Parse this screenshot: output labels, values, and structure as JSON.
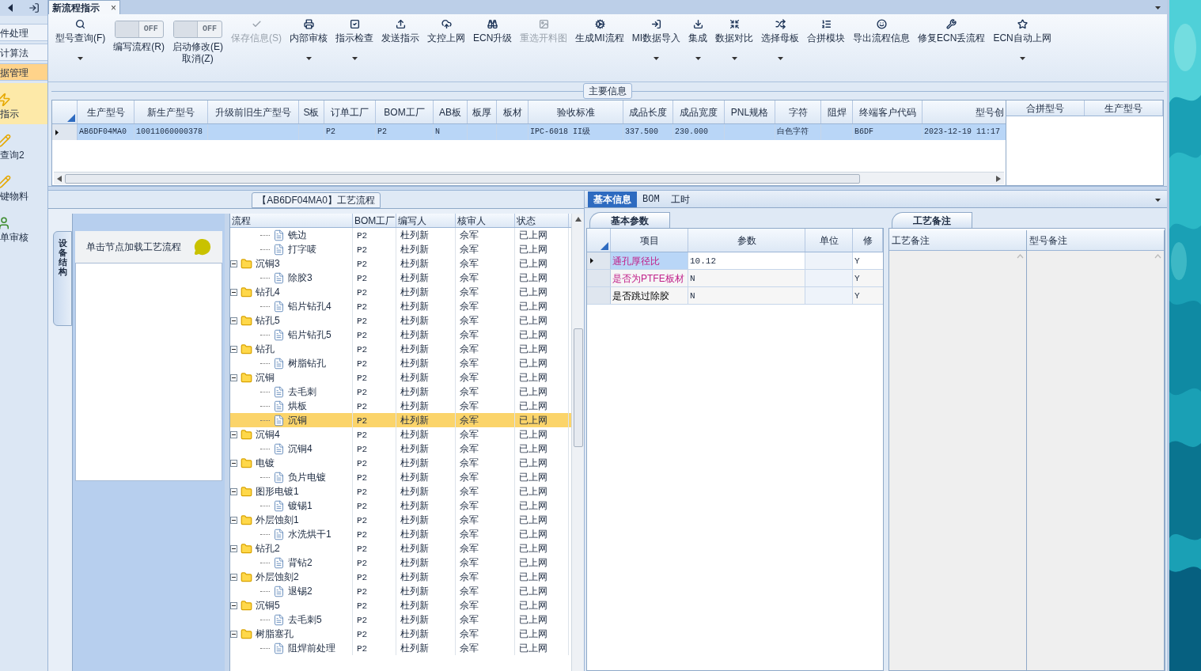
{
  "sidebar": {
    "items": [
      {
        "label": "件处理",
        "kind": "group",
        "selected": false
      },
      {
        "label": "计算法",
        "kind": "group",
        "selected": false
      },
      {
        "label": "据管理",
        "kind": "group",
        "selected": true
      },
      {
        "label": "指示",
        "kind": "item",
        "selected": true
      },
      {
        "label": "查询2",
        "kind": "item",
        "selected": false
      },
      {
        "label": "键物料",
        "kind": "item",
        "selected": false
      },
      {
        "label": "单审核",
        "kind": "item",
        "selected": false
      }
    ]
  },
  "document_tab": {
    "title": "新流程指示",
    "close": "×"
  },
  "toolbar": [
    {
      "label": "型号查询(F)",
      "kind": "button",
      "disabled": false,
      "dropdown": true
    },
    {
      "label": "编写流程(R)",
      "kind": "toggle",
      "on": false,
      "switch_text": "OFF"
    },
    {
      "label": "启动修改(E)",
      "sublabel": "取消(Z)",
      "kind": "toggle",
      "on": false,
      "switch_text": "OFF"
    },
    {
      "label": "保存信息(S)",
      "kind": "button",
      "disabled": true,
      "dropdown": false
    },
    {
      "label": "内部审核",
      "kind": "button",
      "disabled": false,
      "dropdown": true
    },
    {
      "label": "指示检查",
      "kind": "button",
      "disabled": false,
      "dropdown": true
    },
    {
      "label": "发送指示",
      "kind": "button",
      "disabled": false,
      "dropdown": false
    },
    {
      "label": "文控上网",
      "kind": "button",
      "disabled": false,
      "dropdown": false
    },
    {
      "label": "ECN升级",
      "kind": "button",
      "disabled": false,
      "dropdown": false
    },
    {
      "label": "重选开料图",
      "kind": "button",
      "disabled": true,
      "dropdown": false
    },
    {
      "label": "生成MI流程",
      "kind": "button",
      "disabled": false,
      "dropdown": false
    },
    {
      "label": "MI数据导入",
      "kind": "button",
      "disabled": false,
      "dropdown": true
    },
    {
      "label": "集成",
      "kind": "button",
      "disabled": false,
      "dropdown": true
    },
    {
      "label": "数据对比",
      "kind": "button",
      "disabled": false,
      "dropdown": true
    },
    {
      "label": "选择母板",
      "kind": "button",
      "disabled": false,
      "dropdown": true
    },
    {
      "label": "合拼模块",
      "kind": "button",
      "disabled": false,
      "dropdown": false
    },
    {
      "label": "导出流程信息",
      "kind": "button",
      "disabled": false,
      "dropdown": false
    },
    {
      "label": "修复ECN丢流程",
      "kind": "button",
      "disabled": false,
      "dropdown": false
    },
    {
      "label": "ECN自动上网",
      "kind": "button",
      "disabled": false,
      "dropdown": true
    }
  ],
  "main_info": {
    "title": "主要信息",
    "table": {
      "columns": [
        "生产型号",
        "新生产型号",
        "升级前旧生产型号",
        "S板",
        "订单工厂",
        "BOM工厂",
        "AB板",
        "板厚",
        "板材",
        "验收标准",
        "成品长度",
        "成品宽度",
        "PNL规格",
        "字符",
        "阻焊",
        "终端客户代码",
        "型号创"
      ],
      "rows": [
        {
          "selected": true,
          "cells": [
            "AB6DF04MA0",
            "10011060000378",
            null,
            null,
            "P2",
            "P2",
            "N",
            null,
            null,
            "IPC-6018 II级",
            "337.500",
            "230.000",
            null,
            "白色字符",
            null,
            "B6DF",
            "2023-12-19 11:17"
          ]
        }
      ]
    },
    "merge_table": {
      "columns": [
        "合拼型号",
        "生产型号"
      ]
    }
  },
  "flow": {
    "title": "【AB6DF04MA0】工艺流程",
    "side_tab": "设备结构",
    "hint": "单击节点加载工艺流程",
    "columns": [
      "流程",
      "BOM工厂",
      "编写人",
      "核审人",
      "状态"
    ],
    "rows": [
      {
        "name": "铣边",
        "kind": "file",
        "bom_factory": "P2",
        "writer": "杜列新",
        "reviewer": "佘军",
        "status": "已上网",
        "selected": false
      },
      {
        "name": "打字唛",
        "kind": "file",
        "bom_factory": "P2",
        "writer": "杜列新",
        "reviewer": "佘军",
        "status": "已上网",
        "selected": false
      },
      {
        "name": "沉铜3",
        "kind": "folder",
        "expanded": true,
        "bom_factory": "P2",
        "writer": "杜列新",
        "reviewer": "佘军",
        "status": "已上网",
        "selected": false,
        "children": [
          {
            "name": "除胶3",
            "kind": "file",
            "bom_factory": "P2",
            "writer": "杜列新",
            "reviewer": "佘军",
            "status": "已上网",
            "selected": false
          }
        ]
      },
      {
        "name": "钻孔4",
        "kind": "folder",
        "expanded": true,
        "bom_factory": "P2",
        "writer": "杜列新",
        "reviewer": "佘军",
        "status": "已上网",
        "selected": false,
        "children": [
          {
            "name": "铝片钻孔4",
            "kind": "file",
            "bom_factory": "P2",
            "writer": "杜列新",
            "reviewer": "佘军",
            "status": "已上网",
            "selected": false
          }
        ]
      },
      {
        "name": "钻孔5",
        "kind": "folder",
        "expanded": true,
        "bom_factory": "P2",
        "writer": "杜列新",
        "reviewer": "佘军",
        "status": "已上网",
        "selected": false,
        "children": [
          {
            "name": "铝片钻孔5",
            "kind": "file",
            "bom_factory": "P2",
            "writer": "杜列新",
            "reviewer": "佘军",
            "status": "已上网",
            "selected": false
          }
        ]
      },
      {
        "name": "钻孔",
        "kind": "folder",
        "expanded": true,
        "bom_factory": "P2",
        "writer": "杜列新",
        "reviewer": "佘军",
        "status": "已上网",
        "selected": false,
        "children": [
          {
            "name": "树脂钻孔",
            "kind": "file",
            "bom_factory": "P2",
            "writer": "杜列新",
            "reviewer": "佘军",
            "status": "已上网",
            "selected": false
          }
        ]
      },
      {
        "name": "沉铜",
        "kind": "folder",
        "expanded": true,
        "bom_factory": "P2",
        "writer": "杜列新",
        "reviewer": "佘军",
        "status": "已上网",
        "selected": false,
        "children": [
          {
            "name": "去毛刺",
            "kind": "file",
            "bom_factory": "P2",
            "writer": "杜列新",
            "reviewer": "佘军",
            "status": "已上网",
            "selected": false
          },
          {
            "name": "烘板",
            "kind": "file",
            "bom_factory": "P2",
            "writer": "杜列新",
            "reviewer": "佘军",
            "status": "已上网",
            "selected": false
          },
          {
            "name": "沉铜",
            "kind": "file",
            "bom_factory": "P2",
            "writer": "杜列新",
            "reviewer": "佘军",
            "status": "已上网",
            "selected": true
          }
        ]
      },
      {
        "name": "沉铜4",
        "kind": "folder",
        "expanded": true,
        "bom_factory": "P2",
        "writer": "杜列新",
        "reviewer": "佘军",
        "status": "已上网",
        "selected": false,
        "children": [
          {
            "name": "沉铜4",
            "kind": "file",
            "bom_factory": "P2",
            "writer": "杜列新",
            "reviewer": "佘军",
            "status": "已上网",
            "selected": false
          }
        ]
      },
      {
        "name": "电镀",
        "kind": "folder",
        "expanded": true,
        "bom_factory": "P2",
        "writer": "杜列新",
        "reviewer": "佘军",
        "status": "已上网",
        "selected": false,
        "children": [
          {
            "name": "负片电镀",
            "kind": "file",
            "bom_factory": "P2",
            "writer": "杜列新",
            "reviewer": "佘军",
            "status": "已上网",
            "selected": false
          }
        ]
      },
      {
        "name": "图形电镀1",
        "kind": "folder",
        "expanded": true,
        "bom_factory": "P2",
        "writer": "杜列新",
        "reviewer": "佘军",
        "status": "已上网",
        "selected": false,
        "children": [
          {
            "name": "镀锡1",
            "kind": "file",
            "bom_factory": "P2",
            "writer": "杜列新",
            "reviewer": "佘军",
            "status": "已上网",
            "selected": false
          }
        ]
      },
      {
        "name": "外层蚀刻1",
        "kind": "folder",
        "expanded": true,
        "bom_factory": "P2",
        "writer": "杜列新",
        "reviewer": "佘军",
        "status": "已上网",
        "selected": false,
        "children": [
          {
            "name": "水洗烘干1",
            "kind": "file",
            "bom_factory": "P2",
            "writer": "杜列新",
            "reviewer": "佘军",
            "status": "已上网",
            "selected": false
          }
        ]
      },
      {
        "name": "钻孔2",
        "kind": "folder",
        "expanded": true,
        "bom_factory": "P2",
        "writer": "杜列新",
        "reviewer": "佘军",
        "status": "已上网",
        "selected": false,
        "children": [
          {
            "name": "背钻2",
            "kind": "file",
            "bom_factory": "P2",
            "writer": "杜列新",
            "reviewer": "佘军",
            "status": "已上网",
            "selected": false
          }
        ]
      },
      {
        "name": "外层蚀刻2",
        "kind": "folder",
        "expanded": true,
        "bom_factory": "P2",
        "writer": "杜列新",
        "reviewer": "佘军",
        "status": "已上网",
        "selected": false,
        "children": [
          {
            "name": "退锡2",
            "kind": "file",
            "bom_factory": "P2",
            "writer": "杜列新",
            "reviewer": "佘军",
            "status": "已上网",
            "selected": false
          }
        ]
      },
      {
        "name": "沉铜5",
        "kind": "folder",
        "expanded": true,
        "bom_factory": "P2",
        "writer": "杜列新",
        "reviewer": "佘军",
        "status": "已上网",
        "selected": false,
        "children": [
          {
            "name": "去毛刺5",
            "kind": "file",
            "bom_factory": "P2",
            "writer": "杜列新",
            "reviewer": "佘军",
            "status": "已上网",
            "selected": false
          }
        ]
      },
      {
        "name": "树脂塞孔",
        "kind": "folder",
        "expanded": true,
        "bom_factory": "P2",
        "writer": "杜列新",
        "reviewer": "佘军",
        "status": "已上网",
        "selected": false,
        "children": [
          {
            "name": "阻焊前处理",
            "kind": "file",
            "bom_factory": "P2",
            "writer": "杜列新",
            "reviewer": "佘军",
            "status": "已上网",
            "selected": false
          }
        ]
      }
    ]
  },
  "detail_tabs": [
    {
      "label": "基本信息",
      "selected": true
    },
    {
      "label": "BOM",
      "selected": false
    },
    {
      "label": "工时",
      "selected": false
    }
  ],
  "params": {
    "tab": "基本参数",
    "columns": [
      "项目",
      "参数",
      "单位",
      "修"
    ],
    "rows": [
      {
        "item": "通孔厚径比",
        "value": "10.12",
        "modified": "Y",
        "highlighted": true,
        "selected": true
      },
      {
        "item": "是否为PTFE板材",
        "value": "N",
        "modified": "Y",
        "highlighted": true,
        "selected": false
      },
      {
        "item": "是否跳过除胶",
        "value": "N",
        "modified": "Y",
        "highlighted": false,
        "selected": false
      }
    ]
  },
  "notes": {
    "tab": "工艺备注",
    "columns": [
      "工艺备注",
      "型号备注"
    ]
  }
}
